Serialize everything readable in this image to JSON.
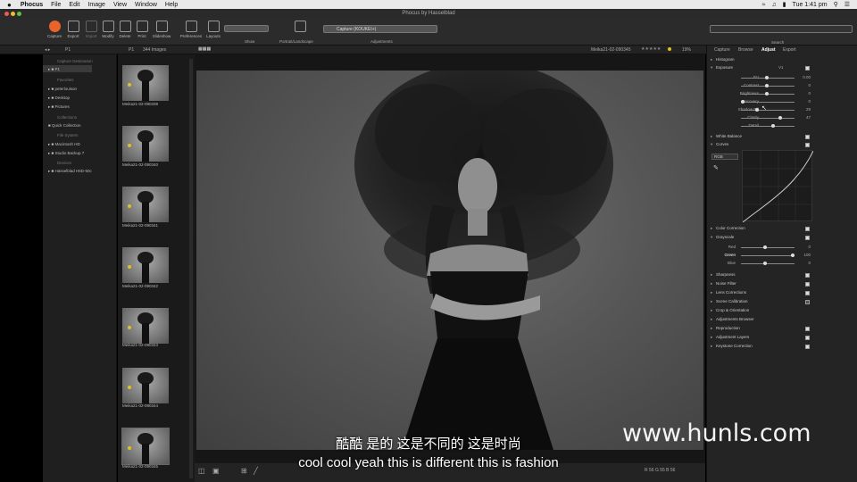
{
  "menubar": {
    "apple": "",
    "items": [
      "Phocus",
      "File",
      "Edit",
      "Image",
      "View",
      "Window",
      "Help"
    ],
    "clock": "Tue 1:41 pm"
  },
  "titlebar": {
    "title": "Phocus by Hasselblad"
  },
  "toolbar": {
    "buttons": [
      {
        "label": "Capture",
        "icon": "capture-icon"
      },
      {
        "label": "Export",
        "icon": "export-icon"
      },
      {
        "label": "Import",
        "icon": "import-icon"
      },
      {
        "label": "Modify",
        "icon": "modify-icon"
      },
      {
        "label": "Delete",
        "icon": "delete-icon"
      },
      {
        "label": "Print",
        "icon": "print-icon"
      },
      {
        "label": "Slideshow",
        "icon": "slideshow-icon"
      },
      {
        "label": "Preferences",
        "icon": "preferences-icon"
      },
      {
        "label": "Layouts",
        "icon": "layouts-icon"
      }
    ],
    "show_label": "Show",
    "portrait_label": "Portrait/Landscape",
    "capture_select": "Capture (KOUKEI+)",
    "adjustments_label": "Adjustments",
    "search_label": "Search"
  },
  "subbar": {
    "folder": "P1",
    "count": "344 Images",
    "filename": "Meika21-02-090345",
    "zoom": "19%"
  },
  "browser": {
    "capture_dest": "Capture Destination",
    "capture_item": "P1",
    "favorites": "Favorites",
    "fav_items": [
      "peterlouison",
      "Desktop",
      "Pictures"
    ],
    "collections": "Collections",
    "quick": "Quick Collection",
    "filesystem": "File System",
    "fs_items": [
      "Macintosh HD",
      "Studio Backup 7"
    ],
    "devices": "Devices",
    "dev_items": [
      "Hasselblad H6D-50c"
    ]
  },
  "thumbnails": [
    "Meika21-02-090339",
    "Meika21-02-090340",
    "Meika21-02-090341",
    "Meika21-02-090342",
    "Meika21-02-090343",
    "Meika21-02-090344",
    "Meika21-02-090345"
  ],
  "rightpanel": {
    "tabs": [
      "Capture",
      "Browse",
      "Adjust",
      "Export"
    ],
    "histogram": "Histogram",
    "exposure": "Exposure",
    "exposure_preset": "V1",
    "exposure_sliders": [
      {
        "label": "EV",
        "value": "0.00",
        "pos": 0.5
      },
      {
        "label": "Contrast",
        "value": "0",
        "pos": 0.5
      },
      {
        "label": "Brightness",
        "value": "0",
        "pos": 0.5
      },
      {
        "label": "Recovery",
        "value": "0",
        "pos": 0.05
      },
      {
        "label": "Shadow Fill",
        "value": "29",
        "pos": 0.3
      },
      {
        "label": "Clarity",
        "value": "47",
        "pos": 0.74
      },
      {
        "label": "Detail",
        "value": "",
        "pos": 0.5
      }
    ],
    "white_balance": "White Balance",
    "curves": "Curves",
    "curves_channel": "RGB",
    "curves_value": "0",
    "color_correction": "Color Correction",
    "grayscale": "Grayscale",
    "gray_sliders": [
      {
        "label": "Red",
        "value": "0",
        "pos": 0.45
      },
      {
        "label": "Green",
        "value": "100",
        "pos": 0.95
      },
      {
        "label": "Blue",
        "value": "0",
        "pos": 0.45
      }
    ],
    "tools_lower": [
      "Sharpness",
      "Noise Filter",
      "Lens Corrections",
      "Scene Calibration",
      "Crop & Orientation",
      "Adjustments Browser",
      "Reproduction",
      "Adjustment Layers",
      "Keystone Correction"
    ]
  },
  "bottombar": {
    "readout": "R 56  G 55  B 56"
  },
  "subtitles": {
    "zh": "酷酷 是的 这是不同的 这是时尚",
    "en": "cool cool yeah this is different this is fashion"
  },
  "watermark": "www.hunls.com",
  "colors": {
    "capture_orange": "#e8642c",
    "rating_yellow": "#e2c21a"
  }
}
